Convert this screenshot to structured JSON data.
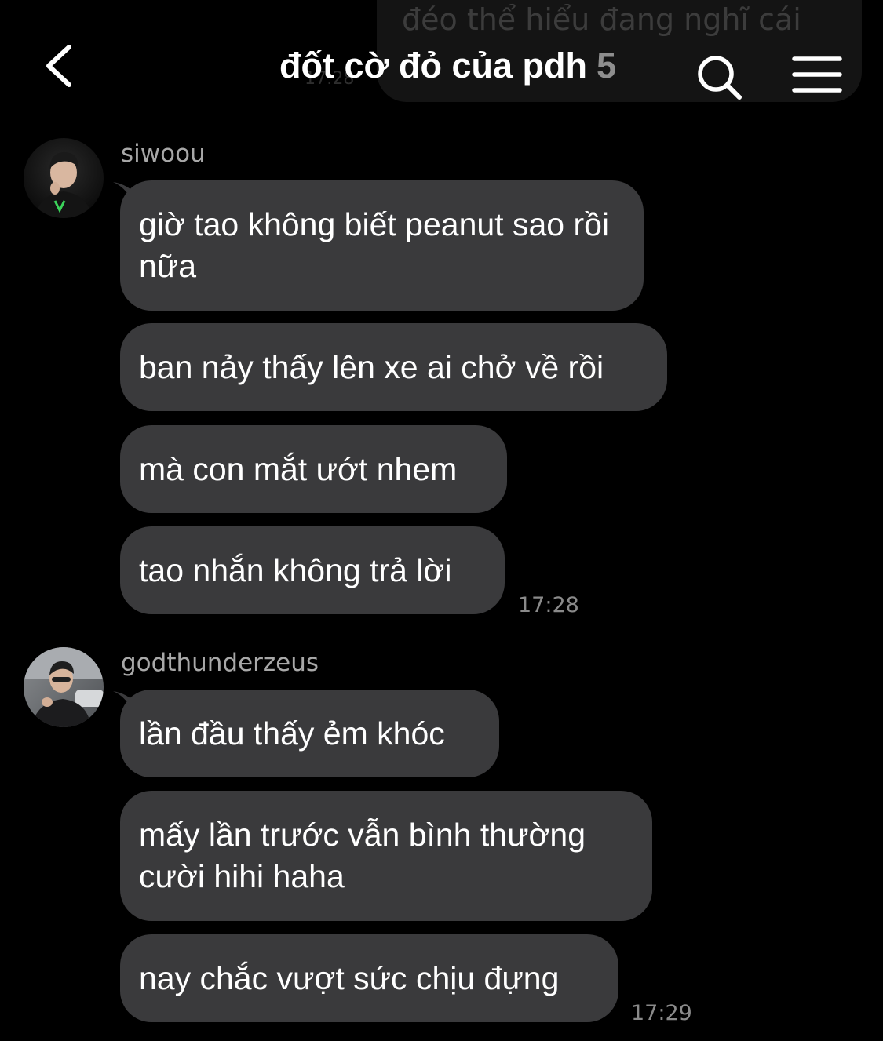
{
  "ghost_message": {
    "text": "đéo thể hiểu đang nghĩ cái",
    "time": "17:28"
  },
  "header": {
    "title": "đốt cờ đỏ của pdh",
    "member_count": "5"
  },
  "icons": {
    "back": "chevron-left-icon",
    "search": "search-icon",
    "menu": "hamburger-menu-icon"
  },
  "colors": {
    "background": "#000000",
    "bubble": "#3a3a3c",
    "secondary_text": "#8e8e8e"
  },
  "groups": [
    {
      "sender": "siwoou",
      "messages": [
        "giờ tao không biết peanut sao rồi nữa",
        "ban nảy thấy lên xe ai chở về rồi",
        "mà con mắt ướt nhem",
        "tao nhắn không trả lời"
      ],
      "time": "17:28"
    },
    {
      "sender": "godthunderzeus",
      "messages": [
        "lần đầu thấy ẻm khóc",
        "mấy lần trước vẫn bình thường cười hihi haha",
        "nay chắc vượt sức chịu đựng"
      ],
      "time": "17:29"
    }
  ]
}
